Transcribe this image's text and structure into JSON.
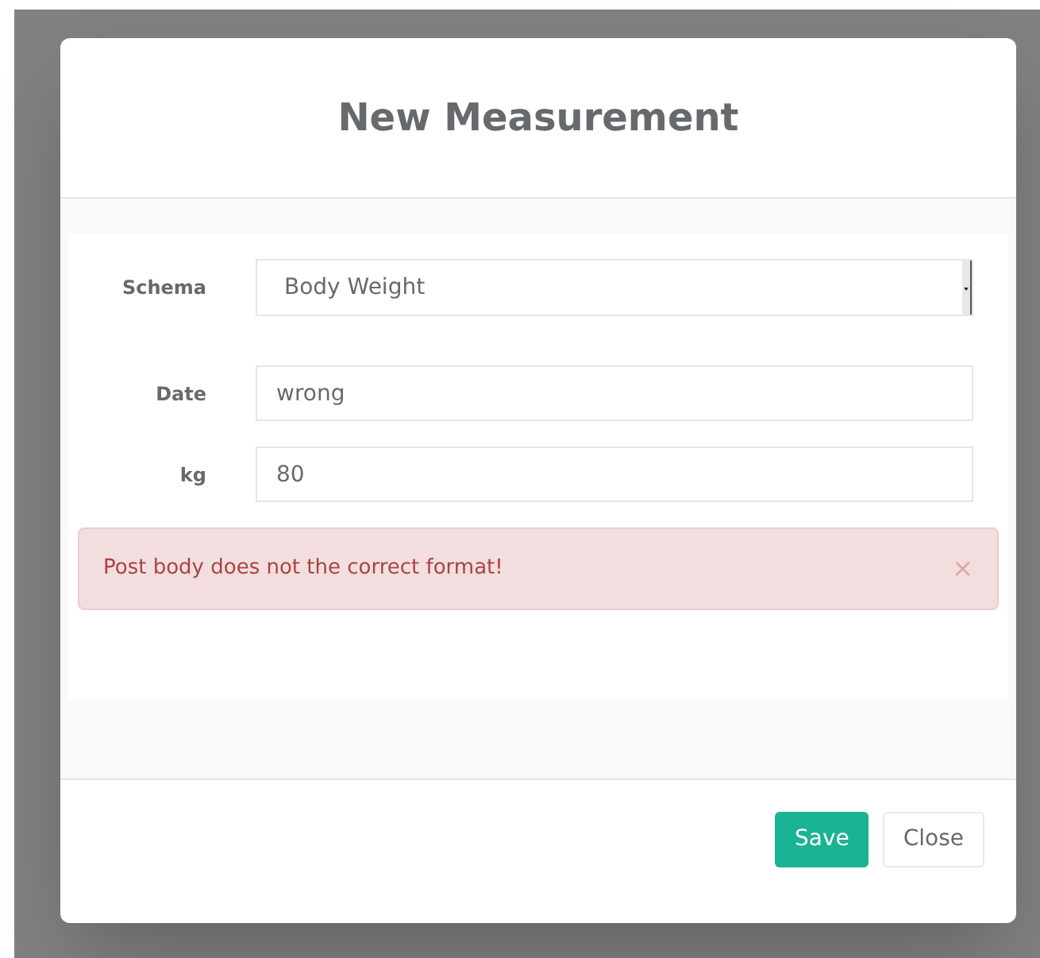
{
  "dialog": {
    "title": "New Measurement",
    "fields": [
      {
        "kind": "select",
        "label": "Schema",
        "value": "Body Weight"
      },
      {
        "kind": "text",
        "label": "Date",
        "value": "wrong"
      },
      {
        "kind": "text",
        "label": "kg",
        "value": "80"
      }
    ],
    "alert": {
      "message": "Post body does not the correct format!",
      "close": "×"
    },
    "buttons": [
      {
        "label": "Save",
        "kind": "primary"
      },
      {
        "label": "Close",
        "kind": "default"
      }
    ]
  }
}
